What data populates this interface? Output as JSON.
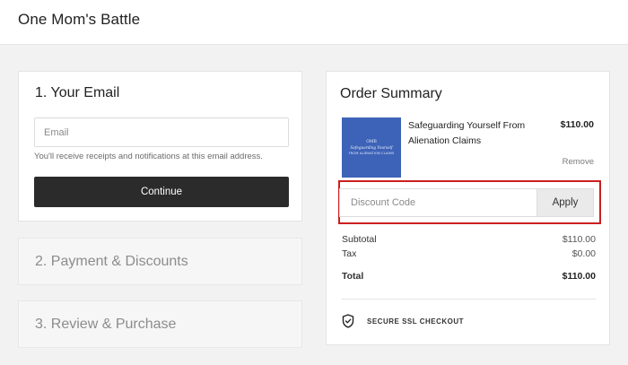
{
  "header": {
    "brand": "One Mom's Battle"
  },
  "email_section": {
    "title": "1.  Your Email",
    "placeholder": "Email",
    "help_text": "You'll receive receipts and notifications at this email address.",
    "continue_label": "Continue"
  },
  "steps": [
    {
      "label": "2.  Payment & Discounts"
    },
    {
      "label": "3.  Review & Purchase"
    }
  ],
  "order_summary": {
    "title": "Order Summary",
    "product": {
      "name": "Safeguarding Yourself From Alienation Claims",
      "price": "$110.00",
      "remove_label": "Remove",
      "thumbnail": {
        "line1": "OMB",
        "line2": "Safeguarding Yourself",
        "line3": "FROM ALIENATION CLAIMS",
        "color": "#3d63b8"
      }
    },
    "discount": {
      "placeholder": "Discount Code",
      "apply_label": "Apply",
      "highlight_color": "#cc1f1f"
    },
    "subtotal": {
      "label": "Subtotal",
      "value": "$110.00"
    },
    "tax": {
      "label": "Tax",
      "value": "$0.00"
    },
    "total": {
      "label": "Total",
      "value": "$110.00"
    },
    "ssl": {
      "icon": "shield-check-icon",
      "label": "SECURE SSL CHECKOUT"
    }
  }
}
